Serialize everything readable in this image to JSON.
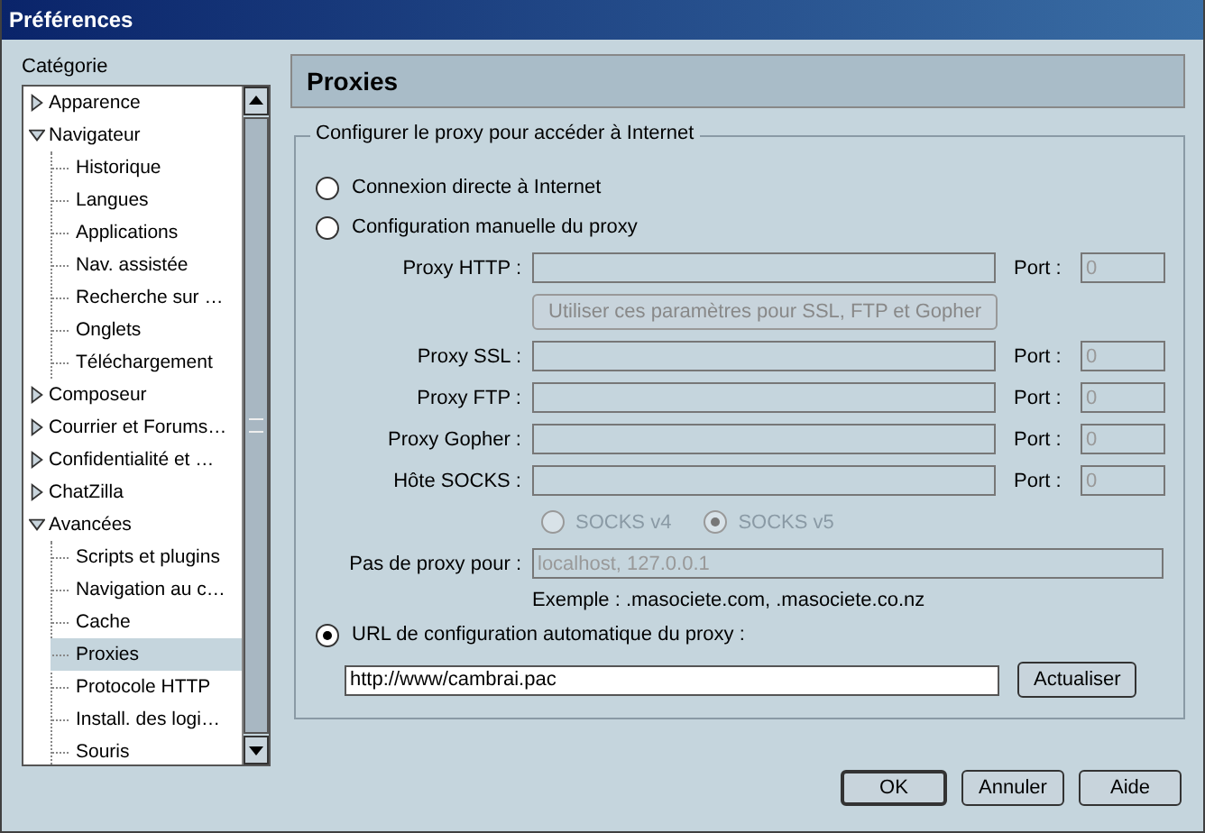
{
  "window": {
    "title": "Préférences"
  },
  "sidebar": {
    "label": "Catégorie",
    "tree": [
      {
        "label": "Apparence",
        "expanded": false,
        "selected": false
      },
      {
        "label": "Navigateur",
        "expanded": true,
        "selected": false,
        "children": [
          {
            "label": "Historique",
            "selected": false
          },
          {
            "label": "Langues",
            "selected": false
          },
          {
            "label": "Applications",
            "selected": false
          },
          {
            "label": "Nav. assistée",
            "selected": false
          },
          {
            "label": "Recherche sur …",
            "selected": false
          },
          {
            "label": "Onglets",
            "selected": false
          },
          {
            "label": "Téléchargement",
            "selected": false
          }
        ]
      },
      {
        "label": "Composeur",
        "expanded": false,
        "selected": false
      },
      {
        "label": "Courrier et Forums…",
        "expanded": false,
        "selected": false
      },
      {
        "label": "Confidentialité et …",
        "expanded": false,
        "selected": false
      },
      {
        "label": "ChatZilla",
        "expanded": false,
        "selected": false
      },
      {
        "label": "Avancées",
        "expanded": true,
        "selected": false,
        "children": [
          {
            "label": "Scripts et plugins",
            "selected": false
          },
          {
            "label": "Navigation au c…",
            "selected": false
          },
          {
            "label": "Cache",
            "selected": false
          },
          {
            "label": "Proxies",
            "selected": true
          },
          {
            "label": "Protocole HTTP",
            "selected": false
          },
          {
            "label": "Install. des logi…",
            "selected": false
          },
          {
            "label": "Souris",
            "selected": false
          }
        ]
      }
    ]
  },
  "panel": {
    "title": "Proxies",
    "group_title": "Configurer le proxy pour accéder à Internet",
    "modes": [
      {
        "label": "Connexion directe à Internet",
        "selected": false
      },
      {
        "label": "Configuration manuelle du proxy",
        "selected": false
      },
      {
        "label": "URL de configuration automatique du proxy :",
        "selected": true
      }
    ],
    "proxies": [
      {
        "label": "Proxy HTTP :",
        "port_label": "Port :",
        "port": "0",
        "disabled": true
      },
      {
        "label": "Proxy SSL :",
        "port_label": "Port :",
        "port": "0",
        "disabled": true
      },
      {
        "label": "Proxy FTP :",
        "port_label": "Port :",
        "port": "0",
        "disabled": true
      },
      {
        "label": "Proxy Gopher :",
        "port_label": "Port :",
        "port": "0",
        "disabled": true
      },
      {
        "label": "Hôte SOCKS :",
        "port_label": "Port :",
        "port": "0",
        "disabled": true
      }
    ],
    "copy_button": {
      "label": "Utiliser ces paramètres pour SSL, FTP et Gopher",
      "disabled": true
    },
    "socks_versions": [
      {
        "label": "SOCKS v4",
        "selected": false,
        "disabled": true
      },
      {
        "label": "SOCKS v5",
        "selected": true,
        "disabled": true
      }
    ],
    "no_proxy": {
      "label": "Pas de proxy pour :",
      "value": "localhost, 127.0.0.1",
      "disabled": true
    },
    "example": "Exemple : .masociete.com, .masociete.co.nz",
    "auto_url": {
      "value": "http://www/cambrai.pac"
    },
    "reload_button": {
      "label": "Actualiser"
    }
  },
  "buttons": [
    {
      "label": "OK",
      "default": true
    },
    {
      "label": "Annuler",
      "default": false
    },
    {
      "label": "Aide",
      "default": false
    }
  ]
}
